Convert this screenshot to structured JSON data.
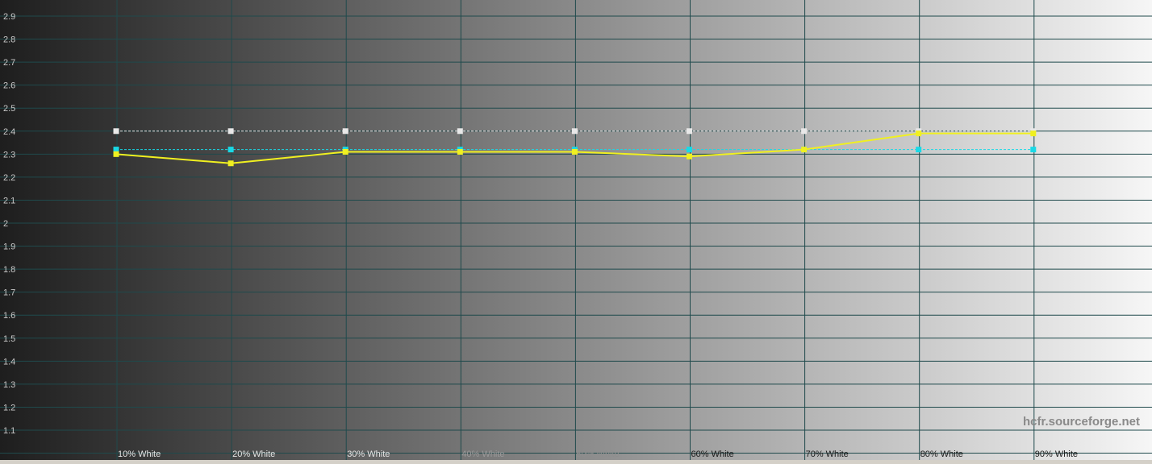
{
  "chart_data": {
    "type": "line",
    "title": "",
    "xlabel": "",
    "ylabel": "",
    "categories": [
      "10% White",
      "20% White",
      "30% White",
      "40% White",
      "50% White",
      "60% White",
      "70% White",
      "80% White",
      "90% White"
    ],
    "y_ticks": [
      "2.9",
      "2.8",
      "2.7",
      "2.6",
      "2.5",
      "2.4",
      "2.3",
      "2.2",
      "2.1",
      "2",
      "1.9",
      "1.8",
      "1.7",
      "1.6",
      "1.5",
      "1.4",
      "1.3",
      "1.2",
      "1.1"
    ],
    "ylim": [
      1.0,
      2.96
    ],
    "grid": true,
    "series": [
      {
        "values": [
          2.3,
          2.26,
          2.31,
          2.31,
          2.31,
          2.29,
          2.32,
          2.39,
          2.39
        ],
        "color": "#f0f020",
        "style": "solid"
      },
      {
        "values": [
          2.32,
          2.32,
          2.32,
          2.32,
          2.32,
          2.32,
          2.32,
          2.32,
          2.32
        ],
        "color": "#19d9e6",
        "style": "dashed"
      },
      {
        "values": [
          2.4,
          2.4,
          2.4,
          2.4,
          2.4,
          2.4,
          2.4,
          2.4,
          2.4
        ],
        "color": "#e8e8e8",
        "style": "dashed"
      }
    ],
    "watermark": "hcfr.sourceforge.net",
    "colors": {
      "grid": "#1f4a4c",
      "background_dark": "#1e1e1e",
      "background_light": "#f6f6f6",
      "watermark": "#8a8a8a"
    }
  }
}
